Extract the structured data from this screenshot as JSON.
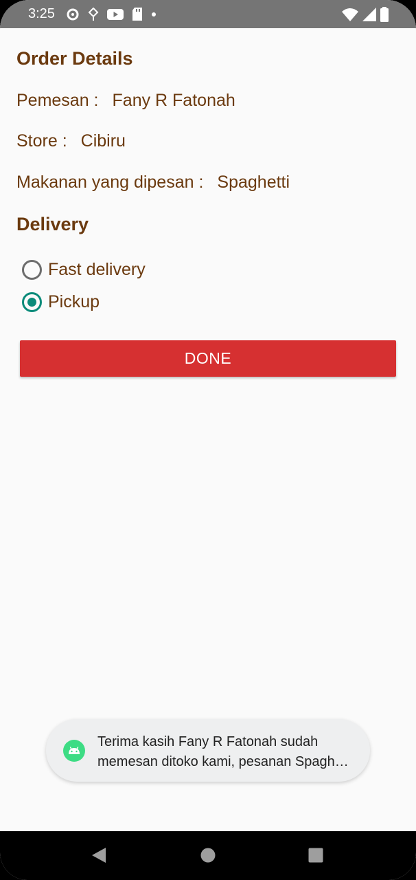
{
  "status_bar": {
    "time": "3:25",
    "left_icons": [
      "headset-icon",
      "download-icon",
      "youtube-icon",
      "sd-card-icon",
      "dot-icon"
    ],
    "right_icons": [
      "wifi-icon",
      "signal-icon",
      "battery-icon"
    ]
  },
  "order": {
    "heading": "Order Details",
    "customer_label": "Pemesan :",
    "customer_value": "Fany R Fatonah",
    "store_label": "Store :",
    "store_value": "Cibiru",
    "food_label": "Makanan yang dipesan :",
    "food_value": "Spaghetti"
  },
  "delivery": {
    "heading": "Delivery",
    "options": [
      {
        "label": "Fast delivery",
        "checked": false
      },
      {
        "label": "Pickup",
        "checked": true
      }
    ]
  },
  "done_button": {
    "label": "DONE",
    "color": "#d63031"
  },
  "toast": {
    "icon": "android-icon",
    "line1": "Terima kasih Fany R Fatonah sudah",
    "line2": "memesan ditoko kami, pesanan Spagh…"
  },
  "nav_bar": {
    "buttons": [
      "back-icon",
      "home-icon",
      "recents-icon"
    ]
  },
  "colors": {
    "text_brown": "#6b3a0f",
    "accent_teal": "#0b8b7a",
    "status_bar": "#757575"
  }
}
